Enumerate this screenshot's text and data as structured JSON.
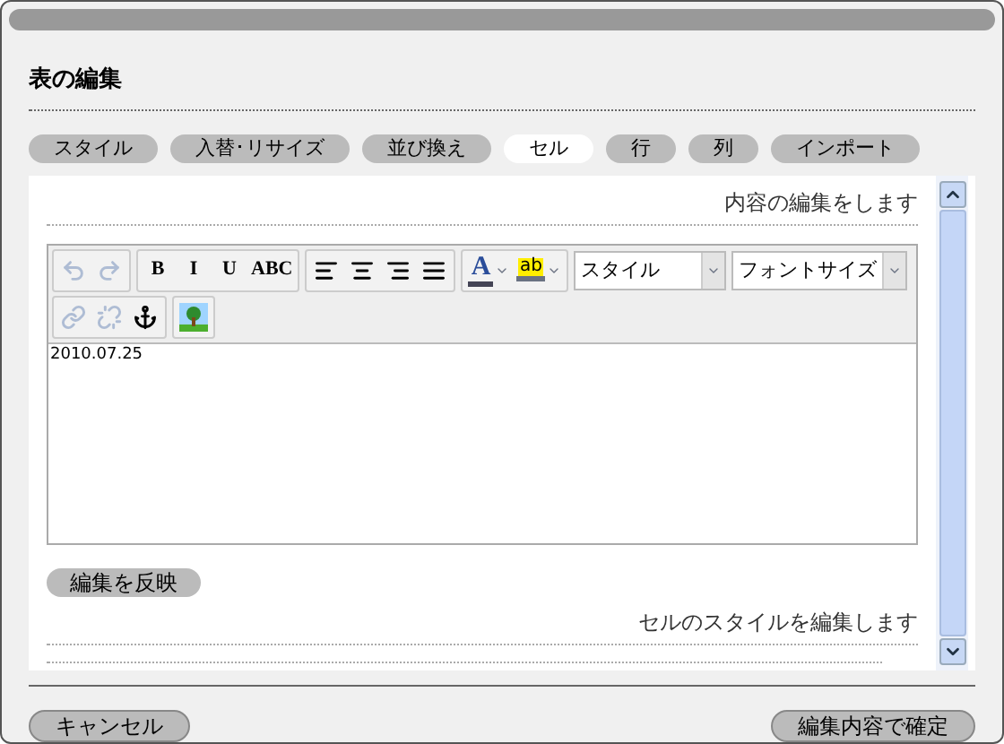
{
  "window": {
    "title": "表の編集"
  },
  "tabs": [
    {
      "label": "スタイル",
      "selected": false
    },
    {
      "label": "入替･リサイズ",
      "selected": false
    },
    {
      "label": "並び換え",
      "selected": false
    },
    {
      "label": "セル",
      "selected": true
    },
    {
      "label": "行",
      "selected": false
    },
    {
      "label": "列",
      "selected": false
    },
    {
      "label": "インポート",
      "selected": false
    }
  ],
  "content_section": {
    "caption": "内容の編集をします"
  },
  "editor": {
    "toolbar": [
      [
        [
          {
            "kind": "undo",
            "disabled": true
          },
          {
            "kind": "redo",
            "disabled": true
          }
        ],
        [
          {
            "kind": "format",
            "glyph": "B",
            "disabled": false
          },
          {
            "kind": "format",
            "glyph": "I",
            "disabled": false
          },
          {
            "kind": "format",
            "glyph": "U",
            "disabled": false
          },
          {
            "kind": "format",
            "glyph": "ABC",
            "disabled": false
          }
        ],
        [
          {
            "kind": "align-left",
            "disabled": false
          },
          {
            "kind": "align-center",
            "disabled": false
          },
          {
            "kind": "align-right",
            "disabled": false
          },
          {
            "kind": "align-justify",
            "disabled": false
          }
        ],
        [
          {
            "kind": "text-color",
            "glyph": "A",
            "disabled": false
          },
          {
            "kind": "highlight",
            "glyph": "ab",
            "disabled": false
          }
        ]
      ],
      [
        [
          {
            "kind": "link",
            "disabled": true
          },
          {
            "kind": "unlink",
            "disabled": true
          },
          {
            "kind": "anchor",
            "disabled": false
          }
        ],
        [
          {
            "kind": "image",
            "disabled": false
          }
        ]
      ]
    ],
    "dropdowns": [
      {
        "value": "スタイル"
      },
      {
        "value": "フォントサイズ"
      }
    ],
    "text": "2010.07.25"
  },
  "apply_button": {
    "label": "編集を反映"
  },
  "style_section": {
    "caption": "セルのスタイルを編集します"
  },
  "buttons": [
    {
      "label": "キャンセル"
    },
    {
      "label": "編集内容で確定"
    }
  ]
}
